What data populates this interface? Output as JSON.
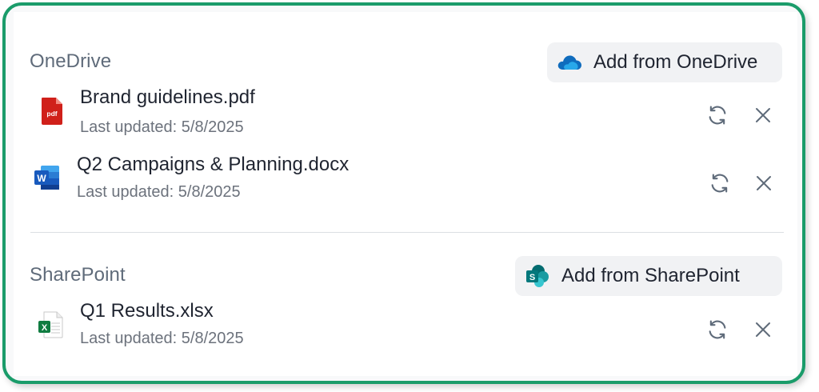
{
  "onedrive": {
    "title": "OneDrive",
    "add_label": "Add from OneDrive",
    "files": [
      {
        "name": "Brand guidelines.pdf",
        "updated": "Last updated: 5/8/2025",
        "type": "pdf",
        "badge": "pdf"
      },
      {
        "name": "Q2 Campaigns & Planning.docx",
        "updated": "Last updated: 5/8/2025",
        "type": "docx",
        "badge": "W"
      }
    ]
  },
  "sharepoint": {
    "title": "SharePoint",
    "add_label": "Add from SharePoint",
    "files": [
      {
        "name": "Q1 Results.xlsx",
        "updated": "Last updated: 5/8/2025",
        "type": "xlsx",
        "badge": "X"
      }
    ]
  },
  "icons": {
    "refresh": "refresh-icon",
    "remove": "close-icon"
  },
  "colors": {
    "frame_border": "#1a9c6a",
    "pdf_red": "#d0201a",
    "word_blue": "#185abd",
    "excel_green": "#107c41",
    "onedrive_blue": "#0f6cbd",
    "sharepoint_teal": "#03787c"
  }
}
